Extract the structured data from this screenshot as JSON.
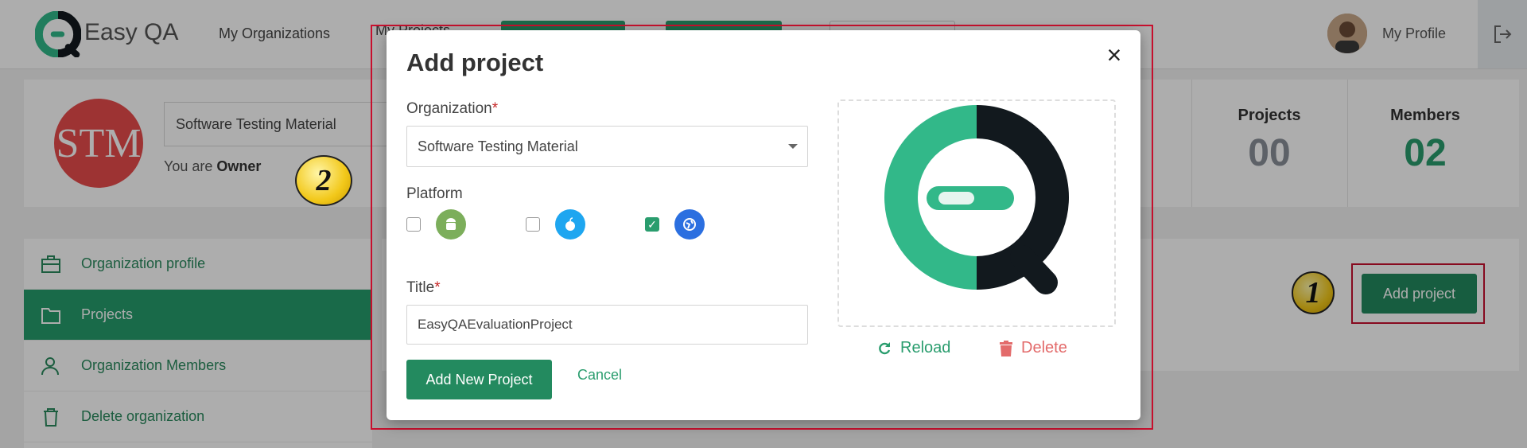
{
  "app": {
    "logo_text": "Easy QA",
    "nav": {
      "organizations": "My Organizations",
      "projects": "My Projects"
    },
    "profile_label": "My Profile"
  },
  "org": {
    "initials": "STM",
    "name_value": "Software Testing Material",
    "role_prefix": "You are",
    "role": "Owner",
    "stats": [
      {
        "label": "Projects",
        "value": "00",
        "color": "#8a9099"
      },
      {
        "label": "Members",
        "value": "02",
        "color": "#2a9d6e"
      }
    ]
  },
  "sidebar": {
    "items": [
      {
        "label": "Organization profile",
        "icon": "briefcase-icon"
      },
      {
        "label": "Projects",
        "icon": "folder-icon"
      },
      {
        "label": "Organization Members",
        "icon": "users-icon"
      },
      {
        "label": "Delete organization",
        "icon": "trash-icon"
      }
    ]
  },
  "main": {
    "add_project_label": "Add project"
  },
  "annotations": {
    "step1": "1",
    "step2": "2"
  },
  "modal": {
    "title": "Add project",
    "close_glyph": "×",
    "organization_label": "Organization",
    "organization_value": "Software Testing Material",
    "platform_label": "Platform",
    "platforms": [
      {
        "name": "android-icon",
        "checked": false,
        "color": "#7cae5b"
      },
      {
        "name": "apple-icon",
        "checked": false,
        "color": "#1ea6f0"
      },
      {
        "name": "web-icon",
        "checked": true,
        "color": "#2b6fe0"
      }
    ],
    "required_mark": "*",
    "title_label": "Title",
    "title_value": "EasyQAEvaluationProject",
    "submit_label": "Add New Project",
    "cancel_label": "Cancel",
    "reload_label": "Reload",
    "delete_label": "Delete"
  },
  "colors": {
    "brand_green": "#2a9d6e",
    "danger": "#e36b6b",
    "logo_green": "#32b889",
    "logo_dark": "#12191e",
    "annotation_red": "#c8102e"
  }
}
